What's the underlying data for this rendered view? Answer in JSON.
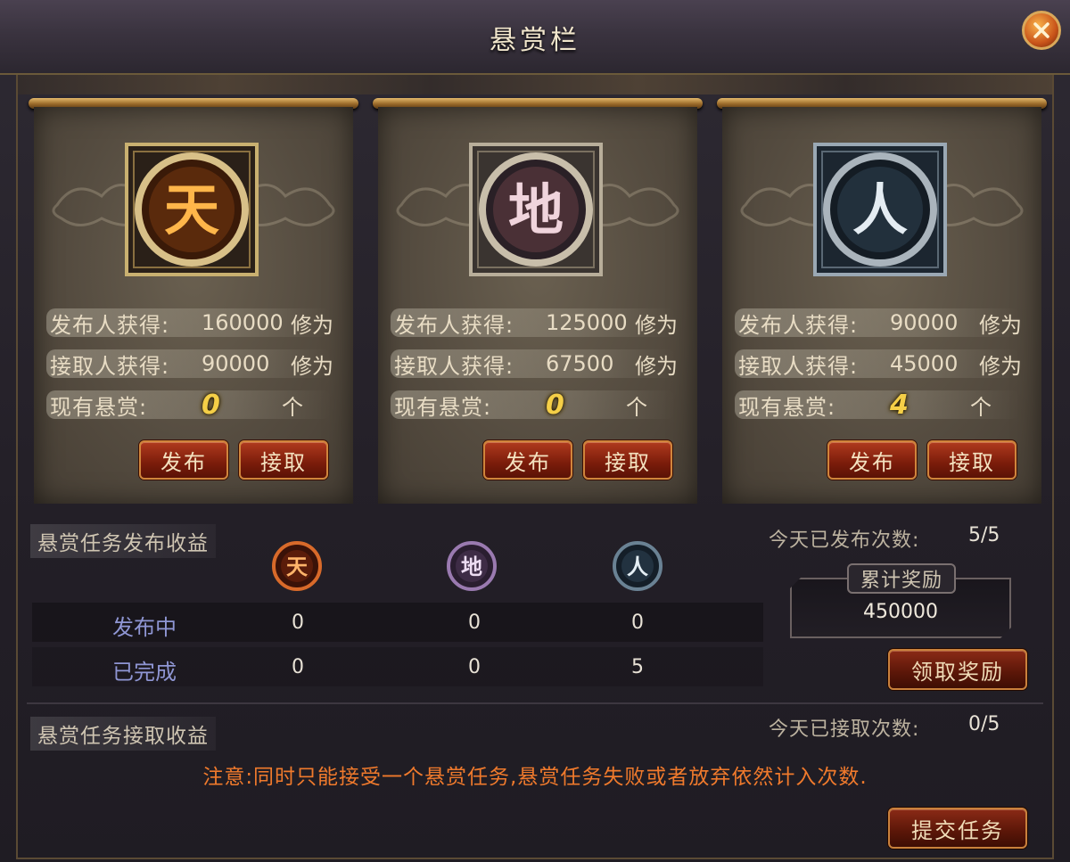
{
  "window": {
    "title": "悬赏栏"
  },
  "cards": [
    {
      "glyph": "天",
      "publisher_label": "发布人获得:",
      "publisher_value": "160000",
      "taker_label": "接取人获得:",
      "taker_value": "90000",
      "unit": "修为",
      "current_label": "现有悬赏:",
      "current_value": "0",
      "count_unit": "个",
      "publish_btn": "发布",
      "accept_btn": "接取",
      "color": "#f5a636"
    },
    {
      "glyph": "地",
      "publisher_label": "发布人获得:",
      "publisher_value": "125000",
      "taker_label": "接取人获得:",
      "taker_value": "67500",
      "unit": "修为",
      "current_label": "现有悬赏:",
      "current_value": "0",
      "count_unit": "个",
      "publish_btn": "发布",
      "accept_btn": "接取",
      "color": "#e8c8d0"
    },
    {
      "glyph": "人",
      "publisher_label": "发布人获得:",
      "publisher_value": "90000",
      "taker_label": "接取人获得:",
      "taker_value": "45000",
      "unit": "修为",
      "current_label": "现有悬赏:",
      "current_value": "4",
      "count_unit": "个",
      "publish_btn": "发布",
      "accept_btn": "接取",
      "color": "#d8e4ec"
    }
  ],
  "publish_section": {
    "title": "悬赏任务发布收益",
    "icons": [
      {
        "glyph": "天"
      },
      {
        "glyph": "地"
      },
      {
        "glyph": "人"
      }
    ],
    "rows": [
      {
        "label": "发布中",
        "values": [
          "0",
          "0",
          "0"
        ]
      },
      {
        "label": "已完成",
        "values": [
          "0",
          "0",
          "5"
        ]
      }
    ],
    "today_label": "今天已发布次数:",
    "today_value": "5/5",
    "reward_label": "累计奖励",
    "reward_value": "450000",
    "claim_btn": "领取奖励"
  },
  "accept_section": {
    "title": "悬赏任务接取收益",
    "today_label": "今天已接取次数:",
    "today_value": "0/5",
    "notice": "注意:同时只能接受一个悬赏任务,悬赏任务失败或者放弃依然计入次数.",
    "submit_btn": "提交任务"
  }
}
